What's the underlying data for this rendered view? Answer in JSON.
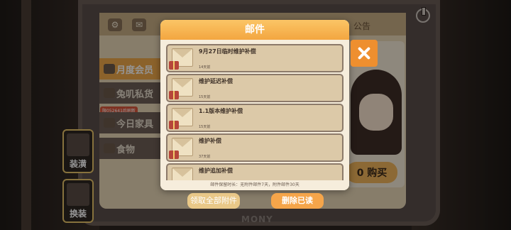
{
  "topbar": {
    "announcement_label": "公告"
  },
  "menu": {
    "items": [
      {
        "label": "月度会员"
      },
      {
        "label": "兔叽私货"
      },
      {
        "label": "今日家具"
      },
      {
        "label": "食物"
      }
    ],
    "promo_tag": "限052641后刷新"
  },
  "side_buttons": {
    "furnish_label": "装潢",
    "outfit_label": "换装"
  },
  "store": {
    "buy_label": "0 购买"
  },
  "device": {
    "brand": "MONY"
  },
  "mail": {
    "title": "邮件",
    "items": [
      {
        "title": "9月27日临时维护补偿",
        "days": "14天前"
      },
      {
        "title": "维护延迟补偿",
        "days": "15天前"
      },
      {
        "title": "1.1版本维护补偿",
        "days": "15天前"
      },
      {
        "title": "维护补偿",
        "days": "37天前"
      },
      {
        "title": "维护追加补偿",
        "days": ""
      }
    ],
    "footer_note": "邮件保留时长：无附件邮件7天，附件邮件30天",
    "collect_all_label": "领取全部附件",
    "delete_read_label": "删除已读"
  }
}
